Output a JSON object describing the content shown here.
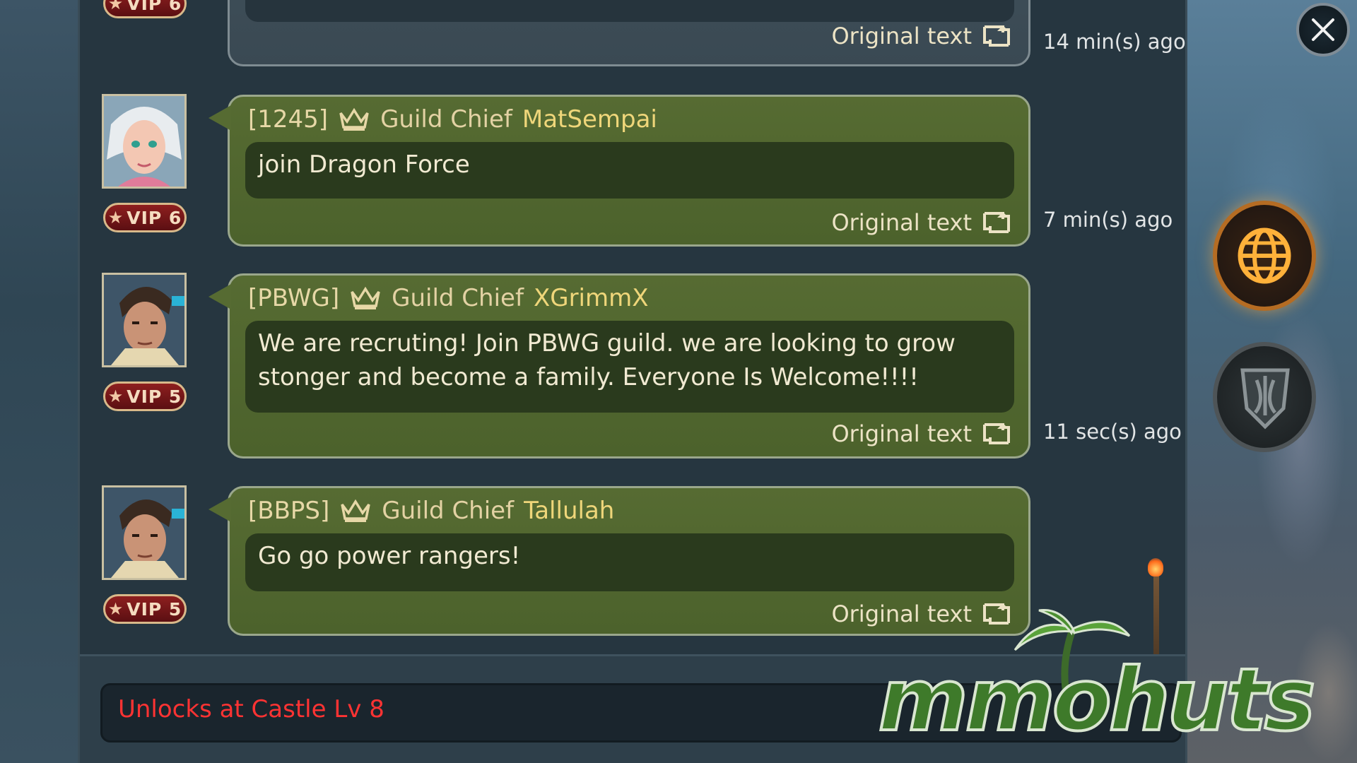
{
  "messages": [
    {
      "vip": "VIP 6",
      "original_text_label": "Original text",
      "time": "14 min(s) ago"
    },
    {
      "tag": "[1245]",
      "rank": "Guild Chief",
      "name": "MatSempai",
      "text": "join Dragon Force",
      "vip": "VIP 6",
      "original_text_label": "Original text",
      "time": "7 min(s) ago"
    },
    {
      "tag": "[PBWG]",
      "rank": "Guild Chief",
      "name": "XGrimmX",
      "text": "We are recruting!  Join PBWG guild. we are looking to grow stonger and become a family. Everyone Is Welcome!!!!",
      "vip": "VIP 5",
      "original_text_label": "Original text",
      "time": "11 sec(s) ago"
    },
    {
      "tag": "[BBPS]",
      "rank": "Guild Chief",
      "name": "Tallulah",
      "text": "Go go power rangers!",
      "vip": "VIP 5",
      "original_text_label": "Original text"
    }
  ],
  "input": {
    "locked_text": "Unlocks at Castle Lv 8"
  },
  "watermark": "mmohuts",
  "colors": {
    "bubble": "#566b32",
    "message_box": "#2a3a1d",
    "name": "#efd67a",
    "lock_text": "#ff3333",
    "world_channel_glow": "#ffaa3c"
  },
  "icons": [
    "close-icon",
    "globe-icon",
    "guild-crest-icon",
    "crown-icon",
    "translate-icon",
    "star-icon"
  ]
}
